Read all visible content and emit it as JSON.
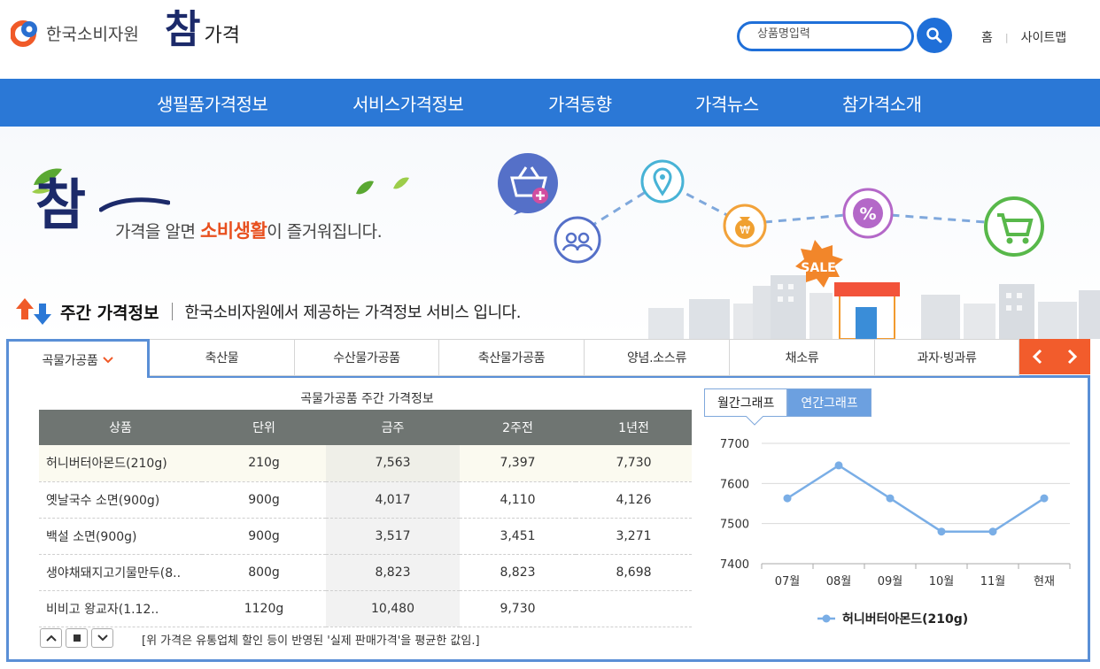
{
  "header": {
    "org_name": "한국소비자원",
    "brand_big": "참",
    "brand_small": "가격",
    "search_placeholder": "상품명입력",
    "links": [
      "홈",
      "사이트맵"
    ]
  },
  "nav": [
    "생필품가격정보",
    "서비스가격정보",
    "가격동향",
    "가격뉴스",
    "참가격소개"
  ],
  "banner": {
    "mark": "참",
    "slogan_pre": "가격을 알면 ",
    "slogan_em": "소비생활",
    "slogan_post": "이 즐거워집니다.",
    "sale": "SALE",
    "won": "₩",
    "percent": "%"
  },
  "weekly": {
    "label": "주간 가격정보",
    "desc": "한국소비자원에서 제공하는 가격정보 서비스 입니다."
  },
  "tabs": [
    "곡물가공품",
    "축산물",
    "수산물가공품",
    "축산물가공품",
    "양념.소스류",
    "채소류",
    "과자·빙과류"
  ],
  "active_tab": "곡물가공품",
  "table": {
    "caption": "곡물가공품 주간 가격정보",
    "headers": [
      "상품",
      "단위",
      "금주",
      "2주전",
      "1년전"
    ],
    "rows": [
      [
        "허니버터아몬드(210g)",
        "210g",
        "7,563",
        "7,397",
        "7,730"
      ],
      [
        "옛날국수 소면(900g)",
        "900g",
        "4,017",
        "4,110",
        "4,126"
      ],
      [
        "백설 소면(900g)",
        "900g",
        "3,517",
        "3,451",
        "3,271"
      ],
      [
        "생야채돼지고기물만두(8..",
        "800g",
        "8,823",
        "8,823",
        "8,698"
      ],
      [
        "비비고 왕교자(1.12..",
        "1120g",
        "10,480",
        "9,730",
        ""
      ]
    ],
    "note": "[위 가격은 유통업체 할인 등이 반영된 '실제 판매가격'을 평균한 값임.]"
  },
  "chart_tabs": [
    "월간그래프",
    "연간그래프"
  ],
  "chart_data": {
    "type": "line",
    "categories": [
      "07월",
      "08월",
      "09월",
      "10월",
      "11월",
      "현재"
    ],
    "series": [
      {
        "name": "허니버터아몬드(210g)",
        "values": [
          7563,
          7645,
          7563,
          7480,
          7480,
          7563
        ]
      }
    ],
    "ylim": [
      7400,
      7700
    ],
    "yticks": [
      "7400",
      "7500",
      "7600",
      "7700"
    ],
    "color": "#7aaee6",
    "grid": true,
    "legend": "bottom"
  }
}
